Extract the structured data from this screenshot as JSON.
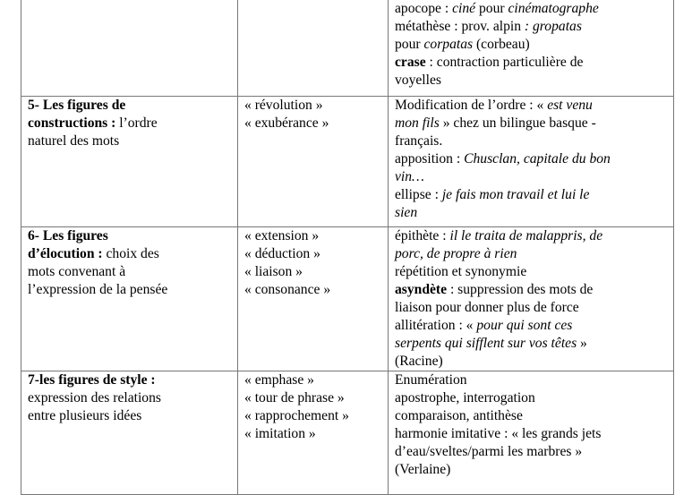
{
  "table": {
    "rows": [
      {
        "col1": [],
        "col2": [],
        "col3": [
          [
            {
              "t": "apocope : "
            },
            {
              "t": "ciné",
              "s": "i"
            },
            {
              "t": " pour "
            },
            {
              "t": "cinématographe",
              "s": "i"
            }
          ],
          [
            {
              "t": "métathèse : prov. alpin "
            },
            {
              "t": ": gropatas",
              "s": "i"
            }
          ],
          [
            {
              "t": "pour "
            },
            {
              "t": "corpatas",
              "s": "i"
            },
            {
              "t": " (corbeau)"
            }
          ],
          [
            {
              "t": "crase",
              "s": "b"
            },
            {
              "t": " : contraction particulière de"
            }
          ],
          [
            {
              "t": "voyelles"
            }
          ]
        ]
      },
      {
        "col1": [
          [
            {
              "t": "5- Les figures de",
              "s": "b"
            }
          ],
          [
            {
              "t": "constructions :",
              "s": "b"
            },
            {
              "t": " l’ordre"
            }
          ],
          [
            {
              "t": "naturel des mots"
            }
          ]
        ],
        "col2": [
          [
            {
              "t": "«  révolution »"
            }
          ],
          [
            {
              "t": "«  exubérance »"
            }
          ]
        ],
        "col3": [
          [
            {
              "t": "Modification de l’ordre : « "
            },
            {
              "t": "est venu",
              "s": "i"
            }
          ],
          [
            {
              "t": "mon fils",
              "s": "i"
            },
            {
              "t": " » chez un bilingue basque -"
            }
          ],
          [
            {
              "t": "français."
            }
          ],
          [
            {
              "t": "apposition : "
            },
            {
              "t": "Chusclan, capitale du bon",
              "s": "i"
            }
          ],
          [
            {
              "t": "vin…",
              "s": "i"
            }
          ],
          [
            {
              "t": "ellipse : "
            },
            {
              "t": "je fais mon travail et lui le",
              "s": "i"
            }
          ],
          [
            {
              "t": "sien",
              "s": "i"
            }
          ]
        ]
      },
      {
        "col1": [
          [
            {
              "t": "6- Les figures",
              "s": "b"
            }
          ],
          [
            {
              "t": "d’élocution :",
              "s": "b"
            },
            {
              "t": " choix des"
            }
          ],
          [
            {
              "t": "mots convenant à"
            }
          ],
          [
            {
              "t": "l’expression de la pensée"
            }
          ]
        ],
        "col2": [
          [
            {
              "t": "«  extension »"
            }
          ],
          [
            {
              "t": "« déduction »"
            }
          ],
          [
            {
              "t": "« liaison »"
            }
          ],
          [
            {
              "t": "« consonance »"
            }
          ]
        ],
        "col3": [
          [
            {
              "t": "épithète : "
            },
            {
              "t": "il le traita de malappris, de",
              "s": "i"
            }
          ],
          [
            {
              "t": "porc, de propre à rien",
              "s": "i"
            }
          ],
          [
            {
              "t": "répétition et synonymie"
            }
          ],
          [
            {
              "t": "asyndète",
              "s": "b"
            },
            {
              "t": " : suppression des mots de"
            }
          ],
          [
            {
              "t": "liaison pour donner plus de force"
            }
          ],
          [
            {
              "t": "allitération : « "
            },
            {
              "t": "pour qui sont ces",
              "s": "i"
            }
          ],
          [
            {
              "t": "serpents qui sifflent sur vos têtes",
              "s": "i"
            },
            {
              "t": " »"
            }
          ],
          [
            {
              "t": "(Racine)"
            }
          ]
        ]
      },
      {
        "col1": [
          [
            {
              "t": "7-les figures de style :",
              "s": "b"
            }
          ],
          [
            {
              "t": "expression des relations"
            }
          ],
          [
            {
              "t": "entre plusieurs idées"
            }
          ]
        ],
        "col2": [
          [
            {
              "t": "« emphase »"
            }
          ],
          [
            {
              "t": "« tour de phrase »"
            }
          ],
          [
            {
              "t": "« rapprochement »"
            }
          ],
          [
            {
              "t": "« imitation »"
            }
          ]
        ],
        "col3": [
          [
            {
              "t": "Enumération"
            }
          ],
          [
            {
              "t": "apostrophe, interrogation"
            }
          ],
          [
            {
              "t": "comparaison, antithèse"
            }
          ],
          [
            {
              "t": "harmonie imitative : «  les grands jets"
            }
          ],
          [
            {
              "t": "d’eau/sveltes/parmi les marbres »"
            }
          ],
          [
            {
              "t": "(Verlaine)"
            }
          ]
        ]
      }
    ]
  }
}
